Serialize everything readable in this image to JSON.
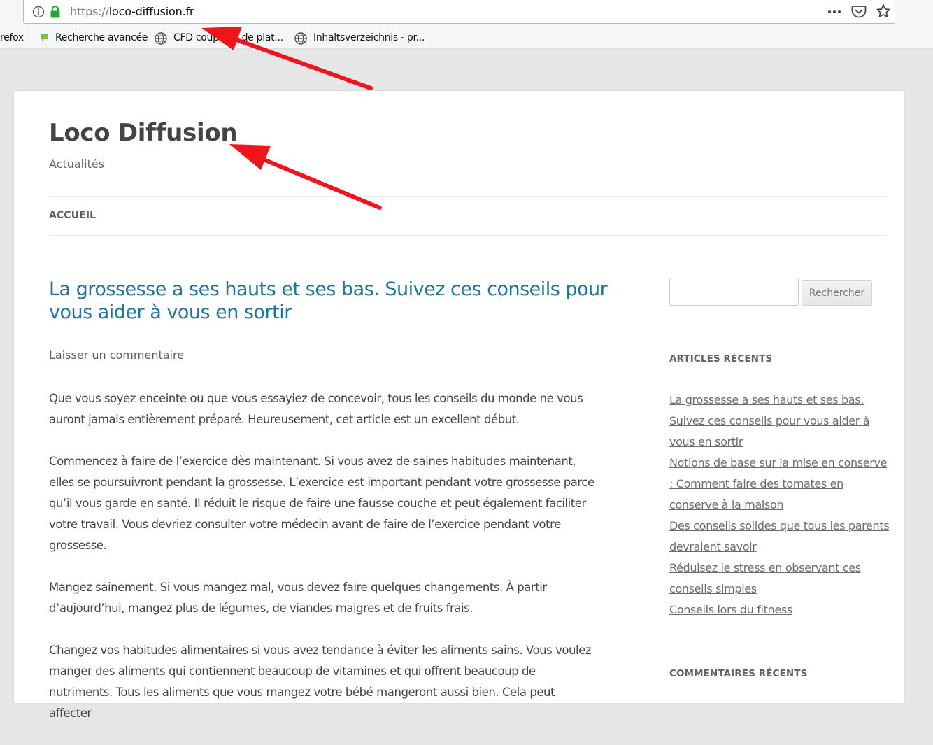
{
  "browser": {
    "url_protocol": "https://",
    "url_host": "loco-diffusion.fr",
    "bookmarks": [
      {
        "label": "refox"
      },
      {
        "label": "Recherche avancée"
      },
      {
        "label": "CFD couplage de plat..."
      },
      {
        "label": "Inhaltsverzeichnis - pr..."
      }
    ],
    "icons": {
      "info": "info-icon",
      "lock": "lock-icon",
      "more": "more-dots-icon",
      "pocket": "pocket-icon",
      "bookmark": "star-icon"
    },
    "lock_color": "#2aa435"
  },
  "site": {
    "title": "Loco Diffusion",
    "tagline": "Actualités",
    "nav": {
      "home": "ACCUEIL"
    }
  },
  "article": {
    "title": "La grossesse a ses hauts et ses bas. Suivez ces conseils pour vous aider à vous en sortir",
    "comment_link": "Laisser un commentaire",
    "paragraphs": [
      "Que vous soyez enceinte ou que vous essayiez de concevoir, tous les conseils du monde ne vous auront jamais entièrement préparé. Heureusement, cet article est un excellent début.",
      "Commencez à faire de l’exercice dès maintenant. Si vous avez de saines habitudes maintenant, elles se poursuivront pendant la grossesse. L’exercice est important pendant votre grossesse parce qu’il vous garde en santé. Il réduit le risque de faire une fausse couche et peut également faciliter votre travail. Vous devriez consulter votre médecin avant de faire de l’exercice pendant votre grossesse.",
      "Mangez sainement. Si vous mangez mal, vous devez faire quelques changements. À partir d’aujourd’hui, mangez plus de légumes, de viandes maigres et de fruits frais.",
      "Changez vos habitudes alimentaires si vous avez tendance à éviter les aliments sains. Vous voulez manger des aliments qui contiennent beaucoup de vitamines et qui offrent beaucoup de nutriments. Tous les aliments que vous mangez votre bébé mangeront aussi bien. Cela peut affecter"
    ]
  },
  "sidebar": {
    "search": {
      "placeholder": "",
      "button_label": "Rechercher"
    },
    "recent_posts_title": "ARTICLES RÉCENTS",
    "recent_posts": [
      "La grossesse a ses hauts et ses bas. Suivez ces conseils pour vous aider à vous en sortir",
      "Notions de base sur la mise en conserve : Comment faire des tomates en conserve à la maison",
      "Des conseils solides que tous les parents devraient savoir",
      "Réduisez le stress en observant ces conseils simples",
      "Conseils lors du fitness"
    ],
    "recent_comments_title": "COMMENTAIRES RÉCENTS"
  },
  "colors": {
    "link_blue": "#21759b",
    "annotation_arrow": "#f0151b",
    "page_bg": "#e6e6e6"
  }
}
